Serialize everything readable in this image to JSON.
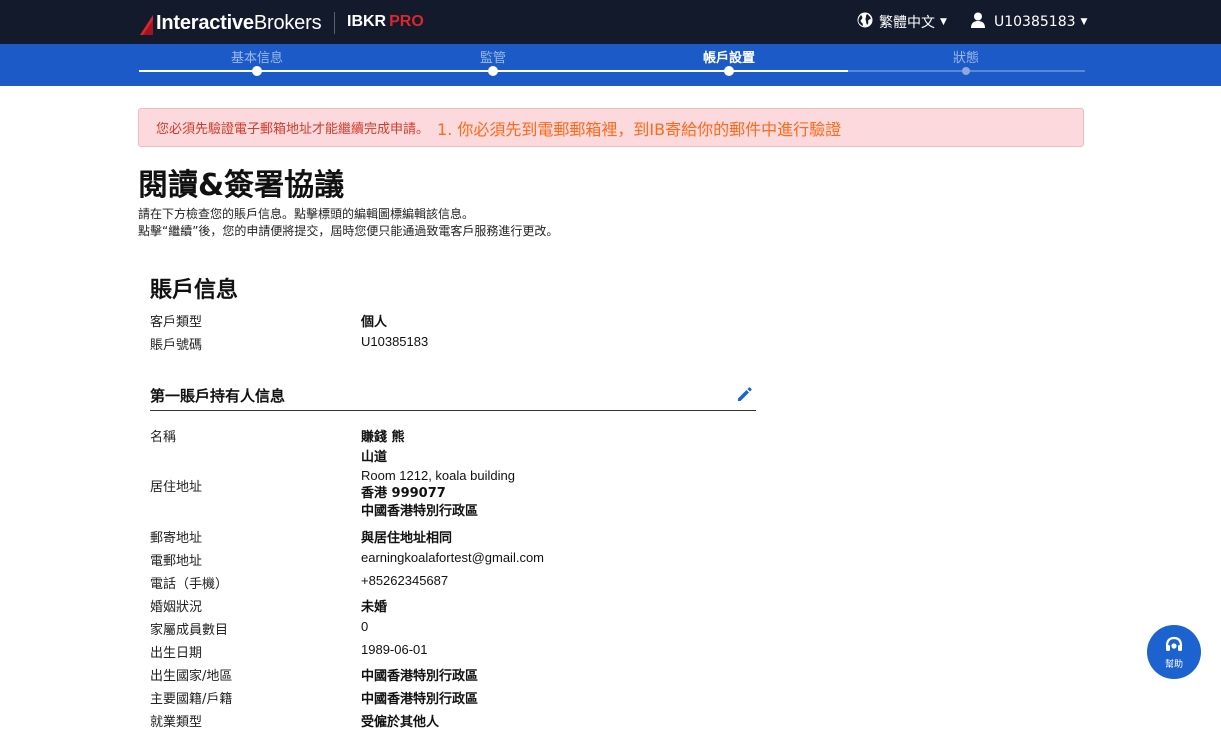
{
  "header": {
    "logo_text_bold": "Interactive",
    "logo_text_light": "Brokers",
    "product": "IBKR",
    "product_suffix": "PRO",
    "language": "繁體中文",
    "user": "U10385183"
  },
  "steps": [
    {
      "label": "基本信息",
      "state": "done"
    },
    {
      "label": "監管",
      "state": "done"
    },
    {
      "label": "帳戶設置",
      "state": "active"
    },
    {
      "label": "狀態",
      "state": "future"
    }
  ],
  "alert": {
    "message": "您必須先驗證電子郵箱地址才能繼續完成申請。",
    "note": "1. 你必須先到電郵郵箱裡，到IB寄給你的郵件中進行驗證"
  },
  "page": {
    "title": "閱讀&簽署協議",
    "intro_line1": "請在下方檢查您的賬戶信息。點擊標頭的編輯圖標編輯該信息。",
    "intro_line2": "點擊“繼續”後，您的申請便將提交，屆時您便只能通過致電客戶服務進行更改。"
  },
  "account_info": {
    "title": "賬戶信息",
    "client_type_label": "客戶類型",
    "client_type_value": "個人",
    "account_no_label": "賬戶號碼",
    "account_no_value": "U10385183"
  },
  "holder": {
    "title": "第一賬戶持有人信息",
    "name_label": "名稱",
    "name_value": "賺錢 熊",
    "address_label": "居住地址",
    "address_line1": "山道",
    "address_line2": "Room 1212, koala building",
    "address_line3": "香港 999077",
    "address_line4": "中國香港特別行政區",
    "mailing_label": "郵寄地址",
    "mailing_value": "與居住地址相同",
    "email_label": "電郵地址",
    "email_value": "earningkoalafortest@gmail.com",
    "phone_label": "電話（手機）",
    "phone_value": "+85262345687",
    "marital_label": "婚姻狀況",
    "marital_value": "未婚",
    "dependents_label": "家屬成員數目",
    "dependents_value": "0",
    "dob_label": "出生日期",
    "dob_value": "1989-06-01",
    "birth_country_label": "出生國家/地區",
    "birth_country_value": "中國香港特別行政區",
    "citizenship_label": "主要國籍/戶籍",
    "citizenship_value": "中國香港特別行政區",
    "employment_label": "就業類型",
    "employment_value": "受僱於其他人"
  },
  "help": {
    "label": "幫助"
  },
  "colors": {
    "topbar": "#121a2b",
    "stepbar": "#1c5bc7",
    "brand_red": "#d7282f",
    "alert_bg": "#fbd9dc",
    "alert_text": "#d23b2b",
    "note_text": "#ff6a1a",
    "help_button": "#1d63d0"
  }
}
